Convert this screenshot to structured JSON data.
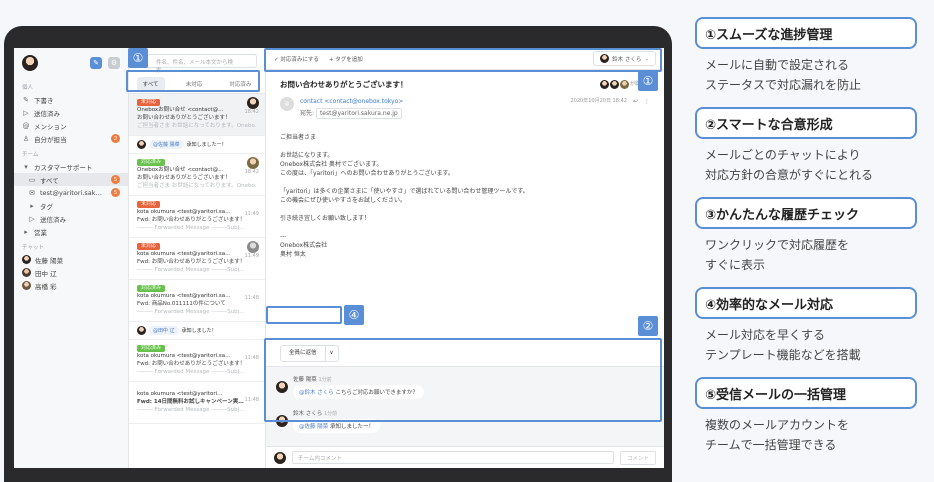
{
  "nav": {
    "sections": {
      "favorites": "個人",
      "team": "チーム",
      "chat": "チャット"
    },
    "items": [
      {
        "label": "下書き",
        "icon": "pencil-icon"
      },
      {
        "label": "送信済み",
        "icon": "send-icon"
      },
      {
        "label": "メンション",
        "icon": "at-icon"
      },
      {
        "label": "自分が担当",
        "icon": "user-icon",
        "badge": "2"
      }
    ],
    "team_name": "カスタマーサポート",
    "team_items": [
      {
        "label": "すべて",
        "badge": "5"
      },
      {
        "label": "test@yaritori.sak…",
        "badge": "5"
      },
      {
        "label": "タグ"
      },
      {
        "label": "送信済み"
      }
    ],
    "other": "営業",
    "chat_users": [
      "佐藤 陽菜",
      "田中 辽",
      "高橋 彩"
    ]
  },
  "list": {
    "search_placeholder": "件名、件名、メール本文から検索",
    "tabs": [
      "すべて",
      "未対応",
      "対応済み"
    ],
    "mails": [
      {
        "tag": "未対応",
        "tag_color": "red",
        "from": "Oneboxお問い合せ <contact@…",
        "subject": "お問い合わせありがとうございます！",
        "preview": "ご担当者さま お世話になっております。Onebo…",
        "time": "18:42"
      },
      {
        "tag": "対応済み",
        "tag_color": "green",
        "from": "Oneboxお問い合せ <contact@…",
        "subject": "お問い合わせありがとうございます！",
        "preview": "ご担当者さま お世話になっております。Onebo…",
        "time": "18:42"
      },
      {
        "tag": "未対応",
        "tag_color": "red",
        "from": "kota okumura <test@yaritori.sa…",
        "subject": "Fwd: お問い合わせありがとうございます！",
        "preview": "-------- Forwarded Message --------Subj…",
        "time": "11:49"
      },
      {
        "tag": "未対応",
        "tag_color": "red",
        "from": "kota okumura <test@yaritori.sa…",
        "subject": "Fwd: お問い合わせありがとうございます！",
        "preview": "-------- Forwarded Message --------Subj…",
        "time": "11:49"
      },
      {
        "tag": "対応済み",
        "tag_color": "green",
        "from": "kota okumura <test@yaritori.sa…",
        "subject": "Fwd: 商品No.011111の件について",
        "preview": "-------- Forwarded Message --------Subj…",
        "time": "11:48"
      },
      {
        "tag": "対応済み",
        "tag_color": "green",
        "from": "kota okumura <test@yaritori.sa…",
        "subject": "Fwd: お問い合わせありがとうございます！",
        "preview": "-------- Forwarded Message --------Subj…",
        "time": "11:48"
      },
      {
        "tag": "",
        "tag_color": "",
        "from": "kota okumura <test@yaritori…",
        "subject": "Fwd: 14日間無料お試しキャンペーン実…",
        "preview": "-------- Forwarded Message --------Subj…",
        "time": "11:48"
      }
    ],
    "chatlines": [
      {
        "mention": "@佐藤 陽菜",
        "text": "承知しましたー！"
      },
      {
        "mention": "@田中 辽",
        "text": "承知しました！"
      }
    ]
  },
  "toolbar": {
    "done_label": "✓ 対応済みにする",
    "tag_label": "+ タグを追加",
    "assignee": "鈴木 さくら"
  },
  "mail": {
    "subject": "お問い合わせありがとうございます！",
    "viewers_label": "が閲覧中",
    "from": "contact <contact@onebox.tokyo>",
    "to_label": "宛先:",
    "to": "test@yaritori.sakura.ne.jp",
    "date": "2020年10月20日 18:42",
    "body": "ご担当者さま\n\nお世話になります。\nOnebox株式会社 奥村でございます。\nこの度は、「yaritori」へのお問い合わせありがとうございます。\n\n「yaritori」は多くの企業さまに「使いやすさ」で選ばれている問い合わせ管理ツールです。\nこの機会にぜひ使いやすさをお試しください。\n\n引き続き宜しくお願い致します！\n\n---\nOnebox株式会社\n奥村 恒太",
    "reply_all": "全員に返信",
    "reply_caret": "∨"
  },
  "chat": {
    "msg1_name": "佐藤 陽菜",
    "msg1_time": "1分前",
    "msg1_mention": "@鈴木 さくら",
    "msg1_text": "こちらご対応お願いできますか？",
    "msg2_name": "鈴木 さくら",
    "msg2_time": "1分前",
    "msg2_mention": "@佐藤 陽菜",
    "msg2_text": "承知しましたー！",
    "comment_placeholder": "チーム内コメント",
    "comment_button": "コメント"
  },
  "callouts": {
    "one": "①",
    "two": "②",
    "four": "④"
  },
  "features": [
    {
      "title": "①スムーズな進捗管理",
      "desc1": "メールに自動で設定される",
      "desc2": "ステータスで対応漏れを防止"
    },
    {
      "title": "②スマートな合意形成",
      "desc1": "メールごとのチャットにより",
      "desc2": "対応方針の合意がすぐにとれる"
    },
    {
      "title": "③かんたんな履歴チェック",
      "desc1": "ワンクリックで対応履歴を",
      "desc2": "すぐに表示"
    },
    {
      "title": "④効率的なメール対応",
      "desc1": "メール対応を早くする",
      "desc2": "テンプレート機能などを搭載"
    },
    {
      "title": "⑤受信メールの一括管理",
      "desc1": "複数のメールアカウントを",
      "desc2": "チームで一括管理できる"
    }
  ],
  "colors": {
    "accent": "#5a8fd6",
    "red_tag": "#e8623c",
    "green_tag": "#66c24a",
    "badge": "#f07b3f"
  }
}
